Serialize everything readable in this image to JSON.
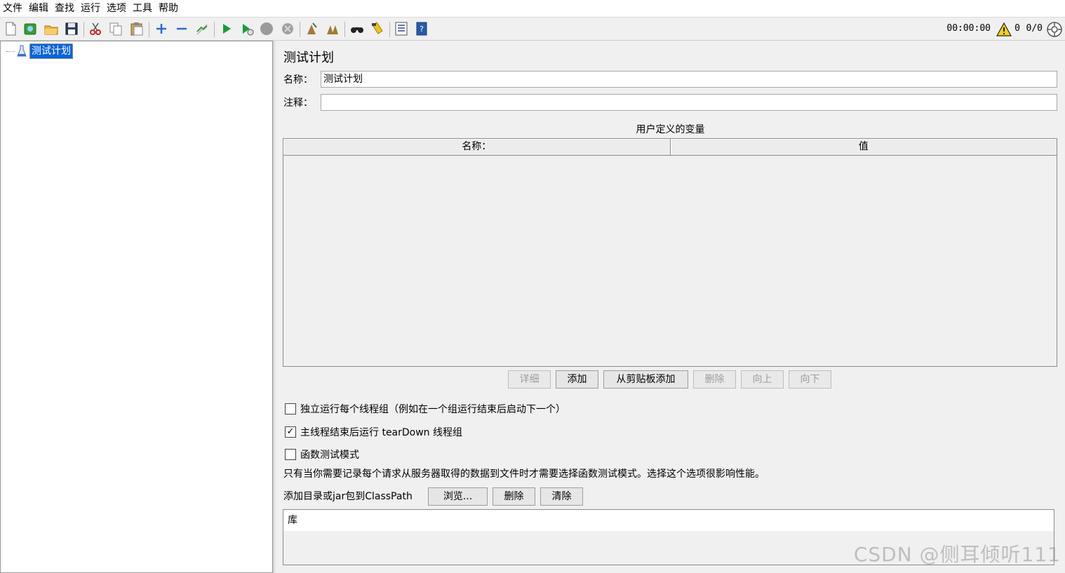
{
  "menu": [
    "文件",
    "编辑",
    "查找",
    "运行",
    "选项",
    "工具",
    "帮助"
  ],
  "toolbar": {
    "icons": [
      "new-file-icon",
      "templates-icon",
      "open-icon",
      "save-icon",
      "cut-icon",
      "copy-icon",
      "paste-icon",
      "expand-icon",
      "collapse-icon",
      "toggle-icon",
      "start-icon",
      "start-no-pauses-icon",
      "stop-icon",
      "shutdown-icon",
      "clear-icon",
      "clear-all-icon",
      "search-icon",
      "reset-search-icon",
      "function-helper-icon",
      "help-icon"
    ],
    "timer": "00:00:00",
    "warning_count": "0",
    "threads": "0/0"
  },
  "tree": {
    "root_label": "测试计划"
  },
  "panel": {
    "title": "测试计划",
    "name_label": "名称：",
    "name_value": "测试计划",
    "comment_label": "注释：",
    "comment_value": "",
    "vars_title": "用户定义的变量",
    "vars_columns": [
      "名称：",
      "值"
    ],
    "buttons": {
      "detail": "详细",
      "add": "添加",
      "add_from_clipboard": "从剪贴板添加",
      "delete": "删除",
      "up": "向上",
      "down": "向下"
    },
    "options": {
      "serialize": "独立运行每个线程组（例如在一个组运行结束后启动下一个）",
      "serialize_checked": false,
      "teardown": "主线程结束后运行 tearDown 线程组",
      "teardown_checked": true,
      "functional": "函数测试模式",
      "functional_checked": false
    },
    "info_text": "只有当你需要记录每个请求从服务器取得的数据到文件时才需要选择函数测试模式。选择这个选项很影响性能。",
    "classpath_label": "添加目录或jar包到ClassPath",
    "classpath_buttons": {
      "browse": "浏览...",
      "delete": "删除",
      "clear": "清除"
    },
    "library_header": "库"
  },
  "watermark": "CSDN @侧耳倾听111"
}
